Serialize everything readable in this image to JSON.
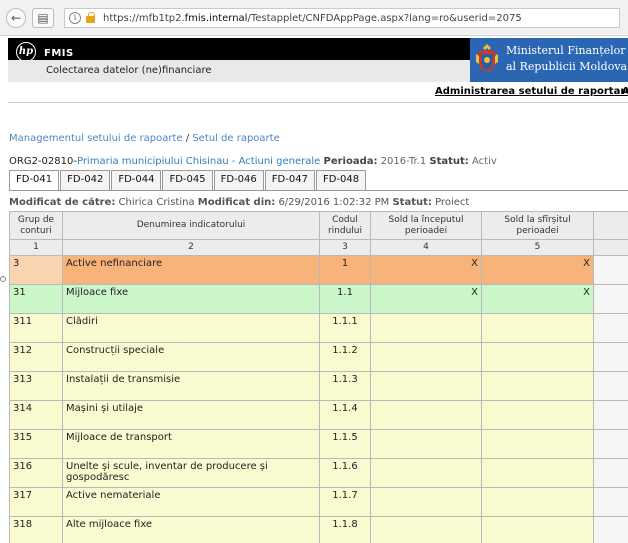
{
  "browser": {
    "url_prefix": "https://mfb1tp2.",
    "url_host": "fmis.internal",
    "url_path": "/Testapplet/CNFDAppPage.aspx?lang=ro&userid=2075",
    "info_glyph": "i",
    "back_glyph": "←",
    "menu_glyph": "▤"
  },
  "header": {
    "logo_text": "hp",
    "app_name": "FMIS",
    "subtitle": "Colectarea datelor (ne)financiare",
    "ministry_line1": "Ministerul Finanțelor",
    "ministry_line2": "al Republicii Moldova"
  },
  "nav": {
    "admin_link": "Administrarea setului de raportare",
    "admin_link_cut": "A"
  },
  "breadcrumb": {
    "item1": "Managementul setului de rapoarte",
    "separator": "/",
    "item2": "Setul de rapoarte"
  },
  "org": {
    "code": "ORG2-02810-",
    "name": "Primaria municipiului Chisinau - Actiuni generale",
    "period_label": "Perioada:",
    "period_value": "2016-Tr.1",
    "status_label": "Statut:",
    "status_value": "Activ"
  },
  "tabs": [
    {
      "label": "FD-041",
      "active": true
    },
    {
      "label": "FD-042",
      "active": false
    },
    {
      "label": "FD-044",
      "active": false
    },
    {
      "label": "FD-045",
      "active": false
    },
    {
      "label": "FD-046",
      "active": false
    },
    {
      "label": "FD-047",
      "active": false
    },
    {
      "label": "FD-048",
      "active": false
    }
  ],
  "modified": {
    "by_label": "Modificat de către:",
    "by_value": "Chirica Cristina",
    "date_label": "Modificat din:",
    "date_value": "6/29/2016 1:02:32 PM",
    "status_label": "Statut:",
    "status_value": "Proiect"
  },
  "table": {
    "headers": [
      "Grup de conturi",
      "Denumirea indicatorului",
      "Codul rindului",
      "Sold la începutul perioadei",
      "Sold la sfîrșitul perioadei"
    ],
    "header_numbers": [
      "1",
      "2",
      "3",
      "4",
      "5"
    ],
    "rows": [
      {
        "group": "3",
        "name": "Active nefinanciare",
        "code": "1",
        "start": "X",
        "end": "X",
        "style": "orange"
      },
      {
        "group": "31",
        "name": "Mijloace fixe",
        "code": "1.1",
        "start": "X",
        "end": "X",
        "style": "green"
      },
      {
        "group": "311",
        "name": "Clădiri",
        "code": "1.1.1",
        "start": "",
        "end": "",
        "style": "yellow"
      },
      {
        "group": "312",
        "name": "Construcții speciale",
        "code": "1.1.2",
        "start": "",
        "end": "",
        "style": "yellow"
      },
      {
        "group": "313",
        "name": "Instalații de transmisie",
        "code": "1.1.3",
        "start": "",
        "end": "",
        "style": "yellow"
      },
      {
        "group": "314",
        "name": "Mașini și utilaje",
        "code": "1.1.4",
        "start": "",
        "end": "",
        "style": "yellow"
      },
      {
        "group": "315",
        "name": "Mijloace de transport",
        "code": "1.1.5",
        "start": "",
        "end": "",
        "style": "yellow"
      },
      {
        "group": "316",
        "name": "Unelte și  scule, inventar de producere și gospodăresc",
        "code": "1.1.6",
        "start": "",
        "end": "",
        "style": "yellow"
      },
      {
        "group": "317",
        "name": "Active nemateriale",
        "code": "1.1.7",
        "start": "",
        "end": "",
        "style": "yellow"
      },
      {
        "group": "318",
        "name": "Alte mijloace fixe",
        "code": "1.1.8",
        "start": "",
        "end": "",
        "style": "yellow"
      }
    ]
  },
  "colors": {
    "header_black": "#000000",
    "ministry_blue": "#2b66b3",
    "link_blue": "#4d86c3",
    "row_orange": "#f8b37b",
    "row_green": "#cbf6c9",
    "row_yellow": "#fafad1"
  }
}
